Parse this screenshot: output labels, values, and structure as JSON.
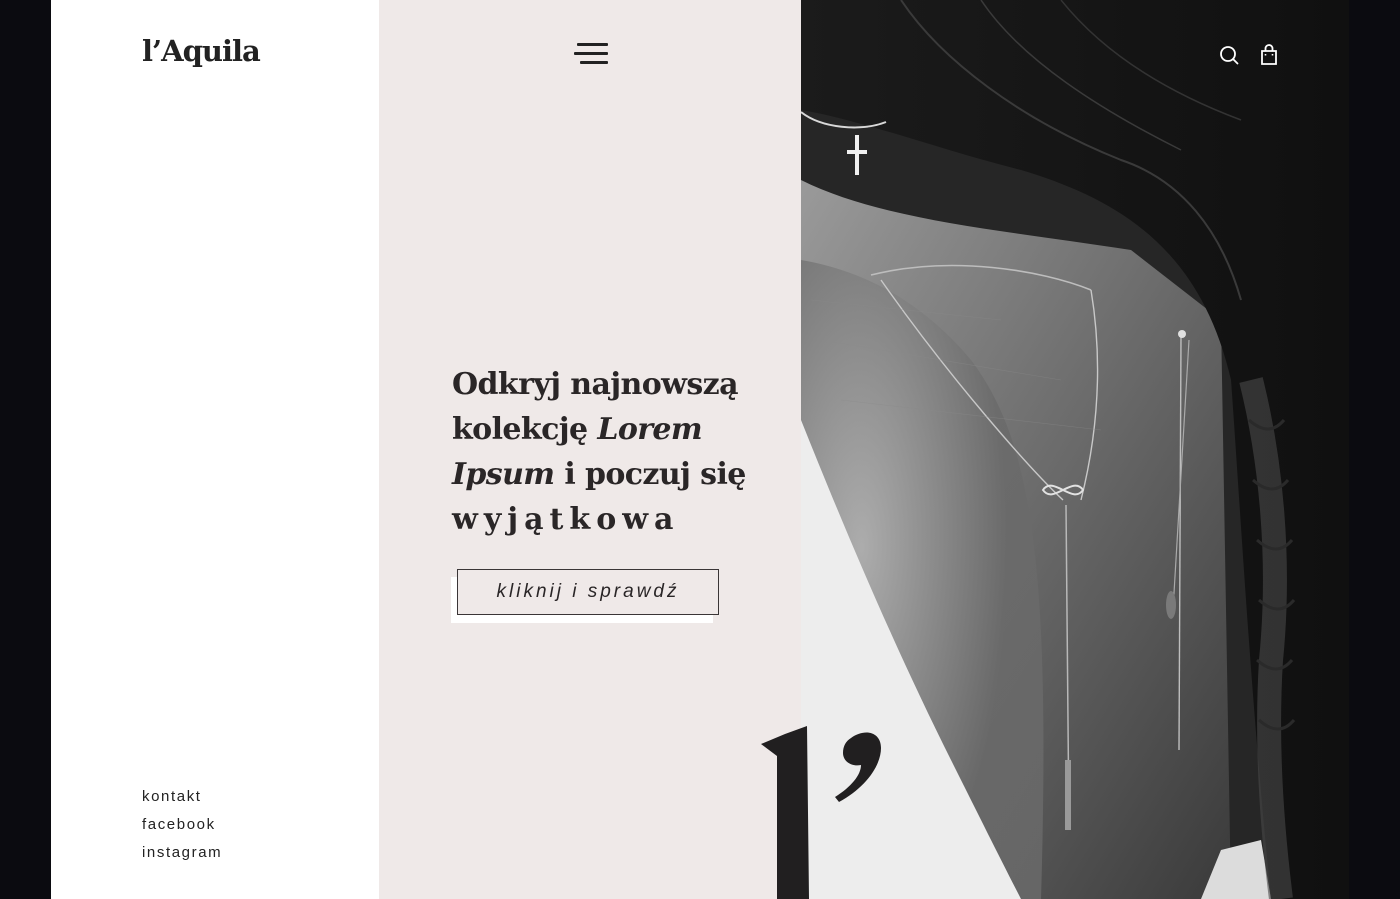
{
  "brand": {
    "logo": "l’Aquila"
  },
  "nav": {
    "menu_icon": "hamburger-icon"
  },
  "header": {
    "icons": [
      "search-icon",
      "cart-icon"
    ]
  },
  "hero": {
    "line1": "Odkryj najnowszą",
    "line2_a": "kolekcję ",
    "line2_em": "Lorem",
    "line3_em": "Ipsum",
    "line3_b": " i poczuj się",
    "line4": "wyjątkowa",
    "cta_label": "kliknij i sprawdź"
  },
  "footer": {
    "links": [
      "kontakt",
      "facebook",
      "instagram"
    ]
  },
  "decor": {
    "big_mark": "l’"
  },
  "colors": {
    "left_bg": "#ffffff",
    "mid_bg": "#efe9e8",
    "text": "#222222",
    "page_bg": "#0b0b10"
  }
}
